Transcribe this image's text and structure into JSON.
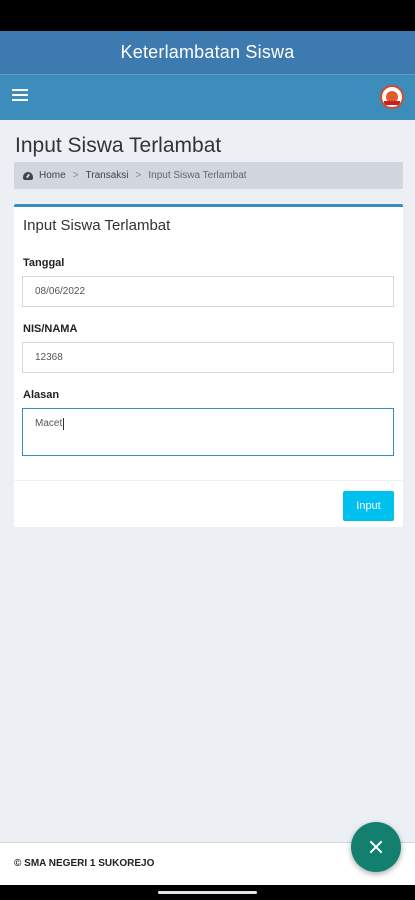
{
  "app": {
    "title": "Keterlambatan Siswa"
  },
  "page": {
    "title": "Input Siswa Terlambat"
  },
  "breadcrumb": {
    "home": "Home",
    "transaksi": "Transaksi",
    "current": "Input Siswa Terlambat"
  },
  "form": {
    "title": "Input Siswa Terlambat",
    "tanggal_label": "Tanggal",
    "tanggal_value": "08/06/2022",
    "nis_label": "NIS/NAMA",
    "nis_value": "12368",
    "alasan_label": "Alasan",
    "alasan_value": "Macet",
    "submit_label": "Input"
  },
  "footer": {
    "text": "© SMA NEGERI 1 SUKOREJO"
  },
  "colors": {
    "app_bar": "#3d7ab0",
    "nav_bar": "#3c8dbc",
    "button": "#00c0ef",
    "fab": "#13806f"
  },
  "icons": {
    "menu": "hamburger-icon",
    "logo": "school-logo",
    "home": "dashboard-icon",
    "fab": "close-icon"
  }
}
